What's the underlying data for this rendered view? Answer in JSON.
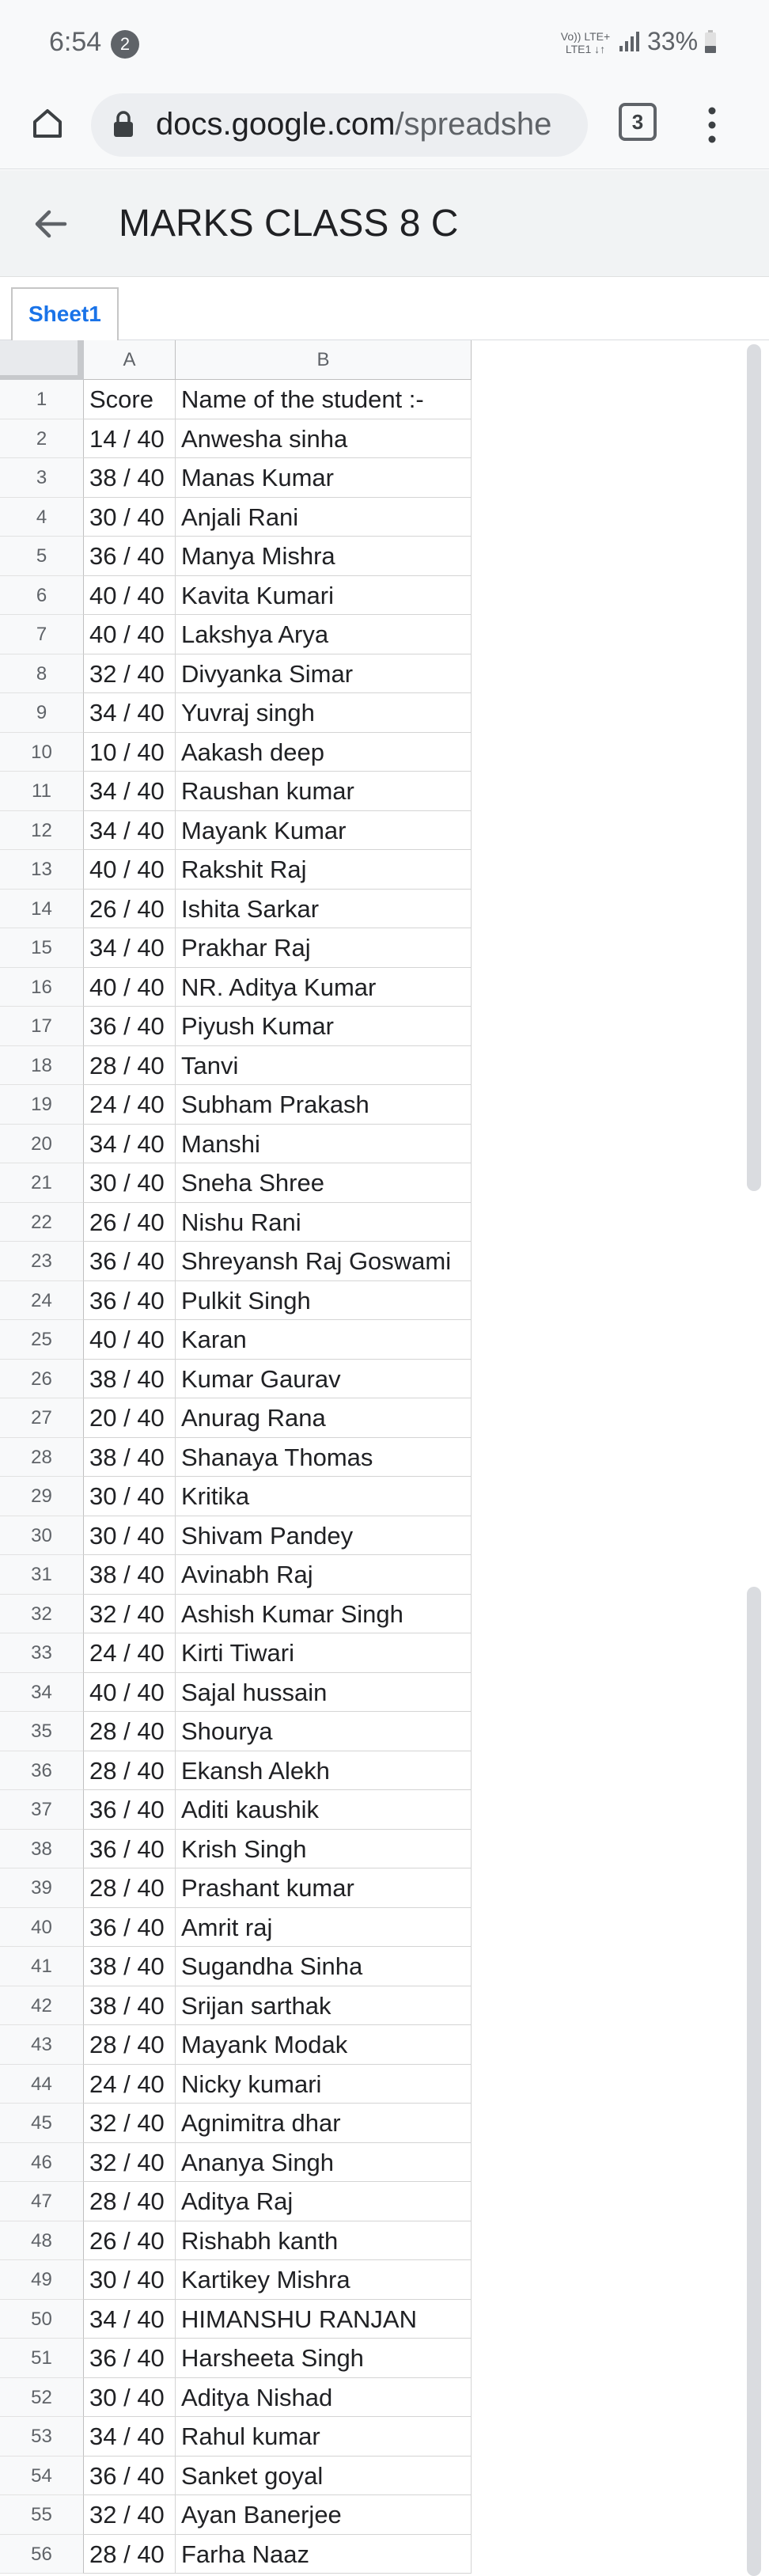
{
  "status_bar": {
    "time": "6:54",
    "notification_count": "2",
    "network_line1": "Vo)) LTE+",
    "network_line2": "LTE1 ↓↑",
    "battery": "33%"
  },
  "browser": {
    "url_domain": "docs.google.com",
    "url_path": "/spreadshe",
    "tab_count": "3"
  },
  "sheet": {
    "title": "MARKS CLASS 8 C",
    "active_tab": "Sheet1",
    "columns": [
      "A",
      "B"
    ],
    "rows": [
      {
        "n": "1",
        "a": "Score",
        "b": "Name of the student :-"
      },
      {
        "n": "2",
        "a": "14 / 40",
        "b": "Anwesha sinha"
      },
      {
        "n": "3",
        "a": "38 / 40",
        "b": "Manas Kumar"
      },
      {
        "n": "4",
        "a": "30 / 40",
        "b": "Anjali Rani"
      },
      {
        "n": "5",
        "a": "36 / 40",
        "b": "Manya Mishra"
      },
      {
        "n": "6",
        "a": "40 / 40",
        "b": "Kavita Kumari"
      },
      {
        "n": "7",
        "a": "40 / 40",
        "b": "Lakshya Arya"
      },
      {
        "n": "8",
        "a": "32 / 40",
        "b": "Divyanka Simar"
      },
      {
        "n": "9",
        "a": "34 / 40",
        "b": "Yuvraj singh"
      },
      {
        "n": "10",
        "a": "10 / 40",
        "b": "Aakash deep"
      },
      {
        "n": "11",
        "a": "34 / 40",
        "b": "Raushan kumar"
      },
      {
        "n": "12",
        "a": "34 / 40",
        "b": "Mayank Kumar"
      },
      {
        "n": "13",
        "a": "40 / 40",
        "b": "Rakshit Raj"
      },
      {
        "n": "14",
        "a": "26 / 40",
        "b": "Ishita Sarkar"
      },
      {
        "n": "15",
        "a": "34 / 40",
        "b": "Prakhar Raj"
      },
      {
        "n": "16",
        "a": "40 / 40",
        "b": "NR. Aditya Kumar"
      },
      {
        "n": "17",
        "a": "36 / 40",
        "b": "Piyush Kumar"
      },
      {
        "n": "18",
        "a": "28 / 40",
        "b": "Tanvi"
      },
      {
        "n": "19",
        "a": "24 / 40",
        "b": "Subham Prakash"
      },
      {
        "n": "20",
        "a": "34 / 40",
        "b": "Manshi"
      },
      {
        "n": "21",
        "a": "30 / 40",
        "b": "Sneha Shree"
      },
      {
        "n": "22",
        "a": "26 / 40",
        "b": "Nishu Rani"
      },
      {
        "n": "23",
        "a": "36 / 40",
        "b": "Shreyansh Raj Goswami"
      },
      {
        "n": "24",
        "a": "36 / 40",
        "b": "Pulkit Singh"
      },
      {
        "n": "25",
        "a": "40 / 40",
        "b": "Karan"
      },
      {
        "n": "26",
        "a": "38 / 40",
        "b": "Kumar Gaurav"
      },
      {
        "n": "27",
        "a": "20 / 40",
        "b": "Anurag Rana"
      },
      {
        "n": "28",
        "a": "38 / 40",
        "b": "Shanaya Thomas"
      },
      {
        "n": "29",
        "a": "30 / 40",
        "b": "Kritika"
      },
      {
        "n": "30",
        "a": "30 / 40",
        "b": "Shivam Pandey"
      },
      {
        "n": "31",
        "a": "38 / 40",
        "b": "Avinabh Raj"
      },
      {
        "n": "32",
        "a": "32 / 40",
        "b": "Ashish Kumar Singh"
      },
      {
        "n": "33",
        "a": "24 / 40",
        "b": "Kirti Tiwari"
      },
      {
        "n": "34",
        "a": "40 / 40",
        "b": "Sajal hussain"
      },
      {
        "n": "35",
        "a": "28 / 40",
        "b": "Shourya"
      },
      {
        "n": "36",
        "a": "28 / 40",
        "b": "Ekansh Alekh"
      },
      {
        "n": "37",
        "a": "36 / 40",
        "b": "Aditi kaushik"
      },
      {
        "n": "38",
        "a": "36 / 40",
        "b": "Krish Singh"
      },
      {
        "n": "39",
        "a": "28 / 40",
        "b": "Prashant kumar"
      },
      {
        "n": "40",
        "a": "36 / 40",
        "b": "Amrit raj"
      },
      {
        "n": "41",
        "a": "38 / 40",
        "b": "Sugandha Sinha"
      },
      {
        "n": "42",
        "a": "38 / 40",
        "b": "Srijan sarthak"
      },
      {
        "n": "43",
        "a": "28 / 40",
        "b": "Mayank Modak"
      },
      {
        "n": "44",
        "a": "24 / 40",
        "b": "Nicky kumari"
      },
      {
        "n": "45",
        "a": "32 / 40",
        "b": "Agnimitra dhar"
      },
      {
        "n": "46",
        "a": "32 / 40",
        "b": "Ananya Singh"
      },
      {
        "n": "47",
        "a": "28 / 40",
        "b": "Aditya Raj"
      },
      {
        "n": "48",
        "a": "26 / 40",
        "b": "Rishabh kanth"
      },
      {
        "n": "49",
        "a": "30 / 40",
        "b": "Kartikey Mishra"
      },
      {
        "n": "50",
        "a": "34 / 40",
        "b": "HIMANSHU RANJAN"
      },
      {
        "n": "51",
        "a": "36 / 40",
        "b": "Harsheeta Singh"
      },
      {
        "n": "52",
        "a": "30 / 40",
        "b": "Aditya Nishad"
      },
      {
        "n": "53",
        "a": "34 / 40",
        "b": "Rahul kumar"
      },
      {
        "n": "54",
        "a": "36 / 40",
        "b": "Sanket goyal"
      },
      {
        "n": "55",
        "a": "32 / 40",
        "b": "Ayan Banerjee"
      },
      {
        "n": "56",
        "a": "28 / 40",
        "b": "Farha Naaz"
      }
    ]
  },
  "colors": {
    "accent": "#1a73e8",
    "header_bg": "#f1f3f4",
    "grid_line": "#d4d4d4"
  },
  "icons": {
    "home": "home-icon",
    "lock": "lock-icon",
    "more": "more-vert-icon",
    "back": "arrow-back-icon"
  }
}
